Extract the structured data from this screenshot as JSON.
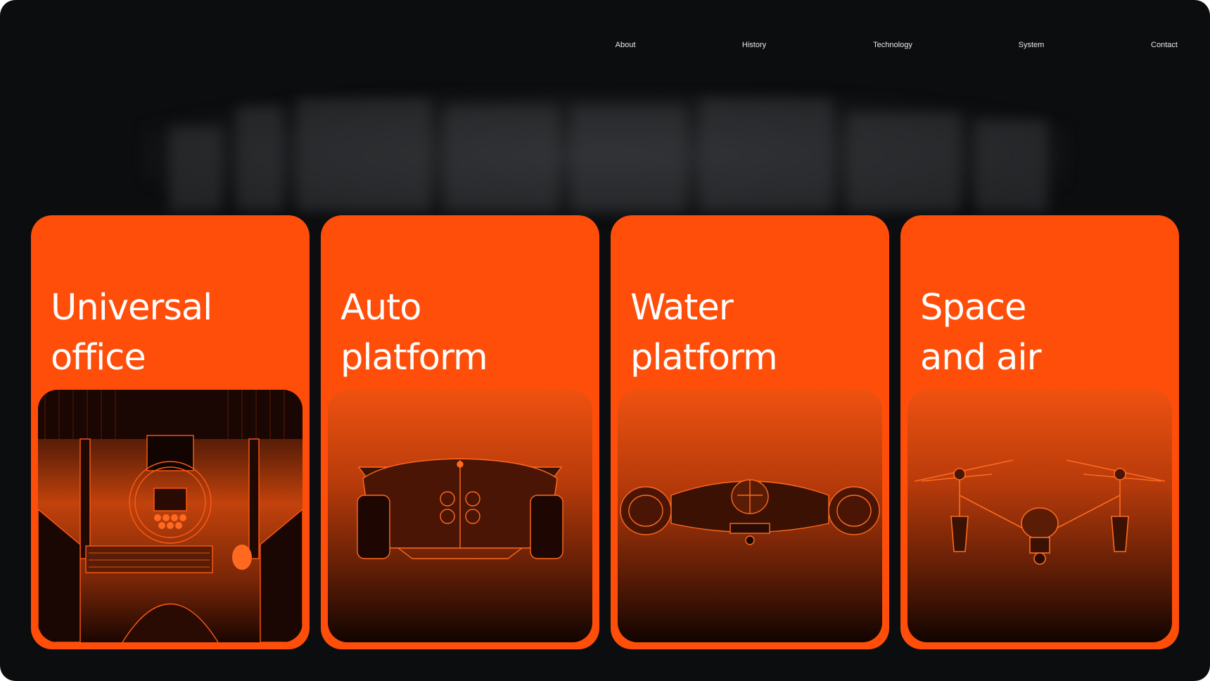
{
  "nav": {
    "items": [
      {
        "label": "About"
      },
      {
        "label": "History"
      },
      {
        "label": "Technology"
      },
      {
        "label": "System"
      },
      {
        "label": "Contact"
      }
    ]
  },
  "cards": [
    {
      "title_line1": "Universal",
      "title_line2": "office",
      "image": "cockpit-workstation-wireframe-icon"
    },
    {
      "title_line1": "Auto",
      "title_line2": "platform",
      "image": "race-car-wireframe-icon"
    },
    {
      "title_line1": "Water",
      "title_line2": "platform",
      "image": "hover-boat-wireframe-icon"
    },
    {
      "title_line1": "Space",
      "title_line2": "and air",
      "image": "drone-wireframe-icon"
    }
  ],
  "colors": {
    "background": "#0c0d0f",
    "card_accent": "#ff4e0a",
    "text": "#ffffff"
  }
}
